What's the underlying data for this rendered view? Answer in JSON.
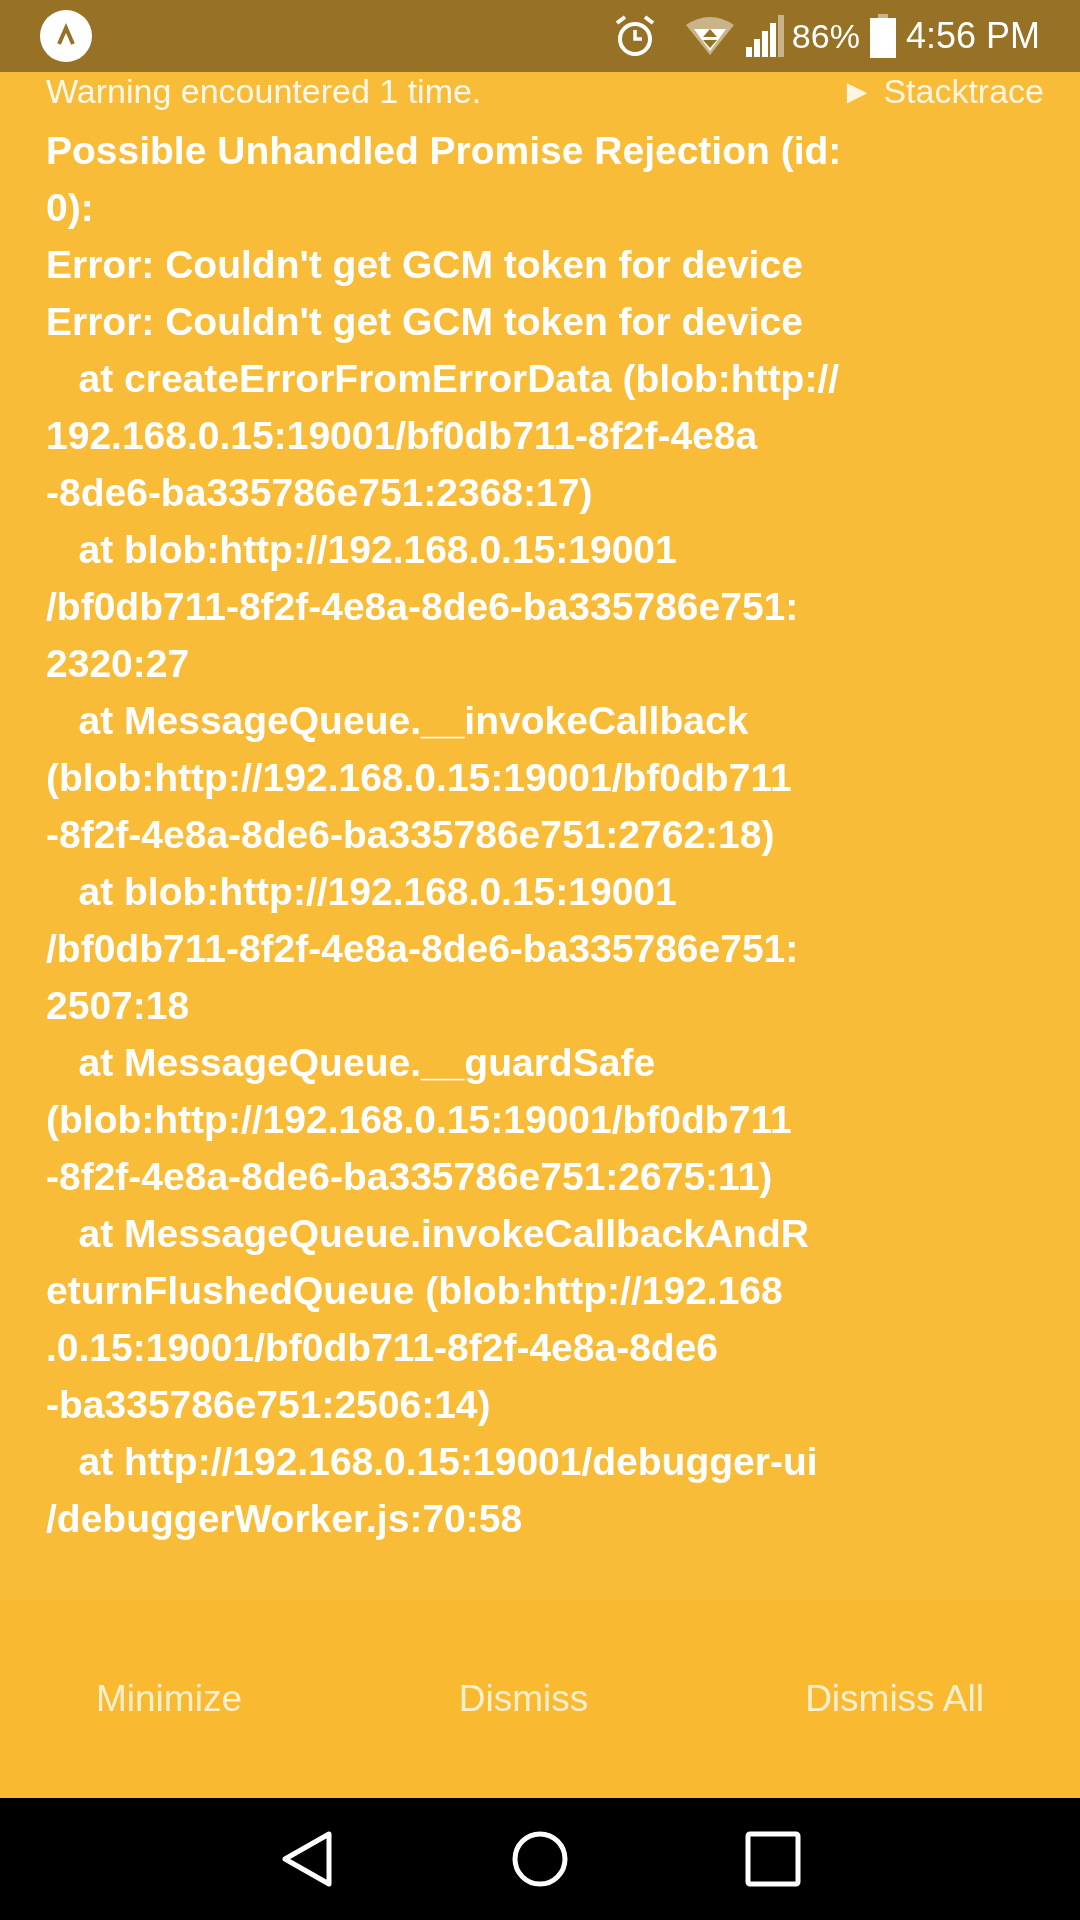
{
  "status_bar": {
    "battery": "86%",
    "time": "4:56 PM"
  },
  "warning": {
    "count_text": "Warning encountered 1 time.",
    "stacktrace_toggle": "► Stacktrace",
    "message_lines": [
      "Possible Unhandled Promise Rejection (id:",
      "0):",
      "Error: Couldn't get GCM token for device",
      "Error: Couldn't get GCM token for device",
      "   at createErrorFromErrorData (blob:http://",
      "192.168.0.15:19001/bf0db711-8f2f-4e8a",
      "-8de6-ba335786e751:2368:17)",
      "   at blob:http://192.168.0.15:19001",
      "/bf0db711-8f2f-4e8a-8de6-ba335786e751:",
      "2320:27",
      "   at MessageQueue.__invokeCallback",
      "(blob:http://192.168.0.15:19001/bf0db711",
      "-8f2f-4e8a-8de6-ba335786e751:2762:18)",
      "   at blob:http://192.168.0.15:19001",
      "/bf0db711-8f2f-4e8a-8de6-ba335786e751:",
      "2507:18",
      "   at MessageQueue.__guardSafe",
      "(blob:http://192.168.0.15:19001/bf0db711",
      "-8f2f-4e8a-8de6-ba335786e751:2675:11)",
      "   at MessageQueue.invokeCallbackAndR",
      "eturnFlushedQueue (blob:http://192.168",
      ".0.15:19001/bf0db711-8f2f-4e8a-8de6",
      "-ba335786e751:2506:14)",
      "   at http://192.168.0.15:19001/debugger-ui",
      "/debuggerWorker.js:70:58"
    ]
  },
  "buttons": [
    "Minimize",
    "Dismiss",
    "Dismiss All"
  ]
}
